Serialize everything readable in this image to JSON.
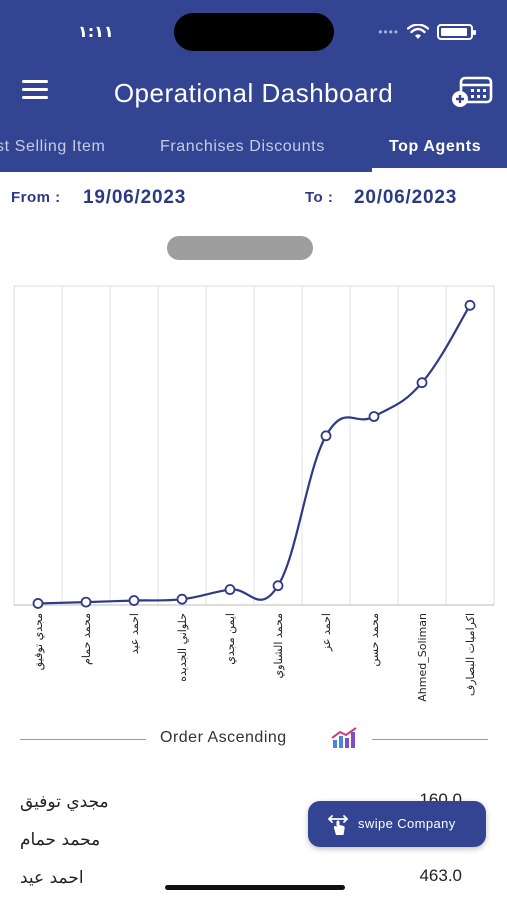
{
  "status_bar": {
    "time": "١:١١"
  },
  "header": {
    "title": "Operational Dashboard"
  },
  "tabs": [
    {
      "label": "st Selling Item",
      "active": false
    },
    {
      "label": "Franchises Discounts",
      "active": false
    },
    {
      "label": "Top Agents",
      "active": true
    }
  ],
  "date_range": {
    "from_label": "From :",
    "from_value": "19/06/2023",
    "to_label": "To :",
    "to_value": "20/06/2023"
  },
  "chart_data": {
    "type": "line",
    "categories": [
      "مجدي توفيق",
      "محمد حمام",
      "احمد عيد",
      "حلواني الجديده",
      "ايمن مجدي",
      "محمد الشناوي",
      "احمد عز",
      "محمد حسن",
      "Ahmed_Soliman",
      "اكراميات البصارف"
    ],
    "values": [
      160,
      300,
      463,
      600,
      1600,
      2000,
      17500,
      19500,
      23000,
      31000
    ],
    "ylim": [
      0,
      33000
    ],
    "grid": true,
    "line_color": "#2e3a85"
  },
  "order": {
    "label": "Order Ascending"
  },
  "list": [
    {
      "name": "مجدي توفيق",
      "value": "160.0"
    },
    {
      "name": "محمد حمام",
      "value": ""
    },
    {
      "name": "احمد عيد",
      "value": "463.0"
    }
  ],
  "swipe": {
    "label": "swipe Company"
  },
  "colors": {
    "primary": "#334592",
    "date_text": "#2b3a84"
  }
}
